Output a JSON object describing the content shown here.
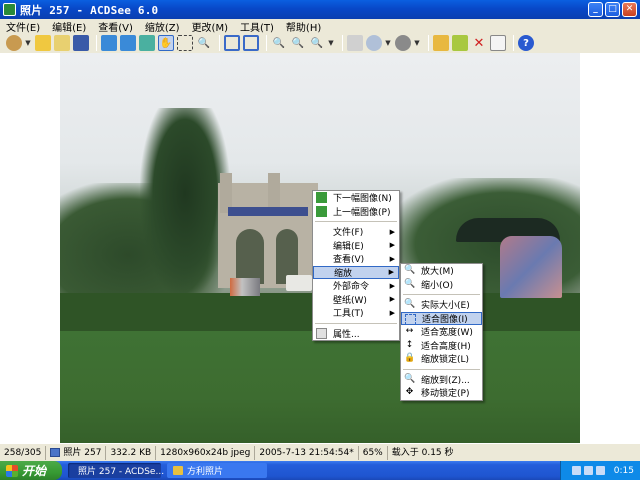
{
  "window": {
    "title": "照片 257 - ACDSee 6.0",
    "minimize_label": "_",
    "maximize_label": "□",
    "close_label": "✕"
  },
  "menubar": [
    "文件(E)",
    "编辑(E)",
    "查看(V)",
    "缩放(Z)",
    "更改(M)",
    "工具(T)",
    "帮助(H)"
  ],
  "toolbar": {
    "icons": [
      "acquire-icon",
      "open-folder-icon",
      "browse-icon",
      "save-icon",
      "prev-image-icon",
      "next-image-icon",
      "rotate-icon",
      "hand-tool-icon",
      "select-tool-icon",
      "zoom-tool-icon",
      "full-screen-icon",
      "fit-window-icon",
      "zoom-in-icon",
      "zoom-out-icon",
      "zoom-menu-icon",
      "print-icon",
      "share-icon",
      "slideshow-icon",
      "copy-to-folder-icon",
      "move-to-folder-icon",
      "delete-icon",
      "properties-icon",
      "help-icon"
    ]
  },
  "context_menu": {
    "items": [
      {
        "label": "下一幅图像(N)",
        "icon": "next-image-icon",
        "submenu": false
      },
      {
        "label": "上一幅图像(P)",
        "icon": "prev-image-icon",
        "submenu": false
      },
      {
        "label": "文件(F)",
        "submenu": true
      },
      {
        "label": "编辑(E)",
        "submenu": true
      },
      {
        "label": "查看(V)",
        "submenu": true
      },
      {
        "label": "缩放",
        "submenu": true,
        "highlighted": true
      },
      {
        "label": "外部命令",
        "submenu": true
      },
      {
        "label": "壁纸(W)",
        "submenu": true
      },
      {
        "label": "工具(T)",
        "submenu": true
      },
      {
        "label": "属性...",
        "icon": "properties-icon",
        "submenu": false
      }
    ]
  },
  "zoom_submenu": {
    "items": [
      {
        "label": "放大(M)",
        "icon": "zoom-in-icon"
      },
      {
        "label": "缩小(O)",
        "icon": "zoom-out-icon"
      },
      {
        "label": "实际大小(E)",
        "icon": "actual-size-icon"
      },
      {
        "label": "适合图像(I)",
        "icon": "fit-image-icon",
        "highlighted": true
      },
      {
        "label": "适合宽度(W)",
        "icon": "fit-width-icon"
      },
      {
        "label": "适合高度(H)",
        "icon": "fit-height-icon"
      },
      {
        "label": "缩放锁定(L)",
        "icon": "zoom-lock-icon"
      },
      {
        "label": "缩放到(Z)...",
        "icon": "zoom-to-icon"
      },
      {
        "label": "移动锁定(P)",
        "icon": "pan-lock-icon"
      }
    ]
  },
  "statusbar": {
    "position": "258/305",
    "filename": "照片 257",
    "filesize": "332.2 KB",
    "dimensions": "1280x960x24b jpeg",
    "datetime": "2005-7-13 21:54:54*",
    "zoom": "65%",
    "load_time": "载入于 0.15 秒"
  },
  "taskbar": {
    "start_label": "开始",
    "tasks": [
      {
        "label": "照片 257 - ACDSe...",
        "active": true
      },
      {
        "label": "方利照片",
        "active": false
      }
    ],
    "clock": "0:15"
  }
}
